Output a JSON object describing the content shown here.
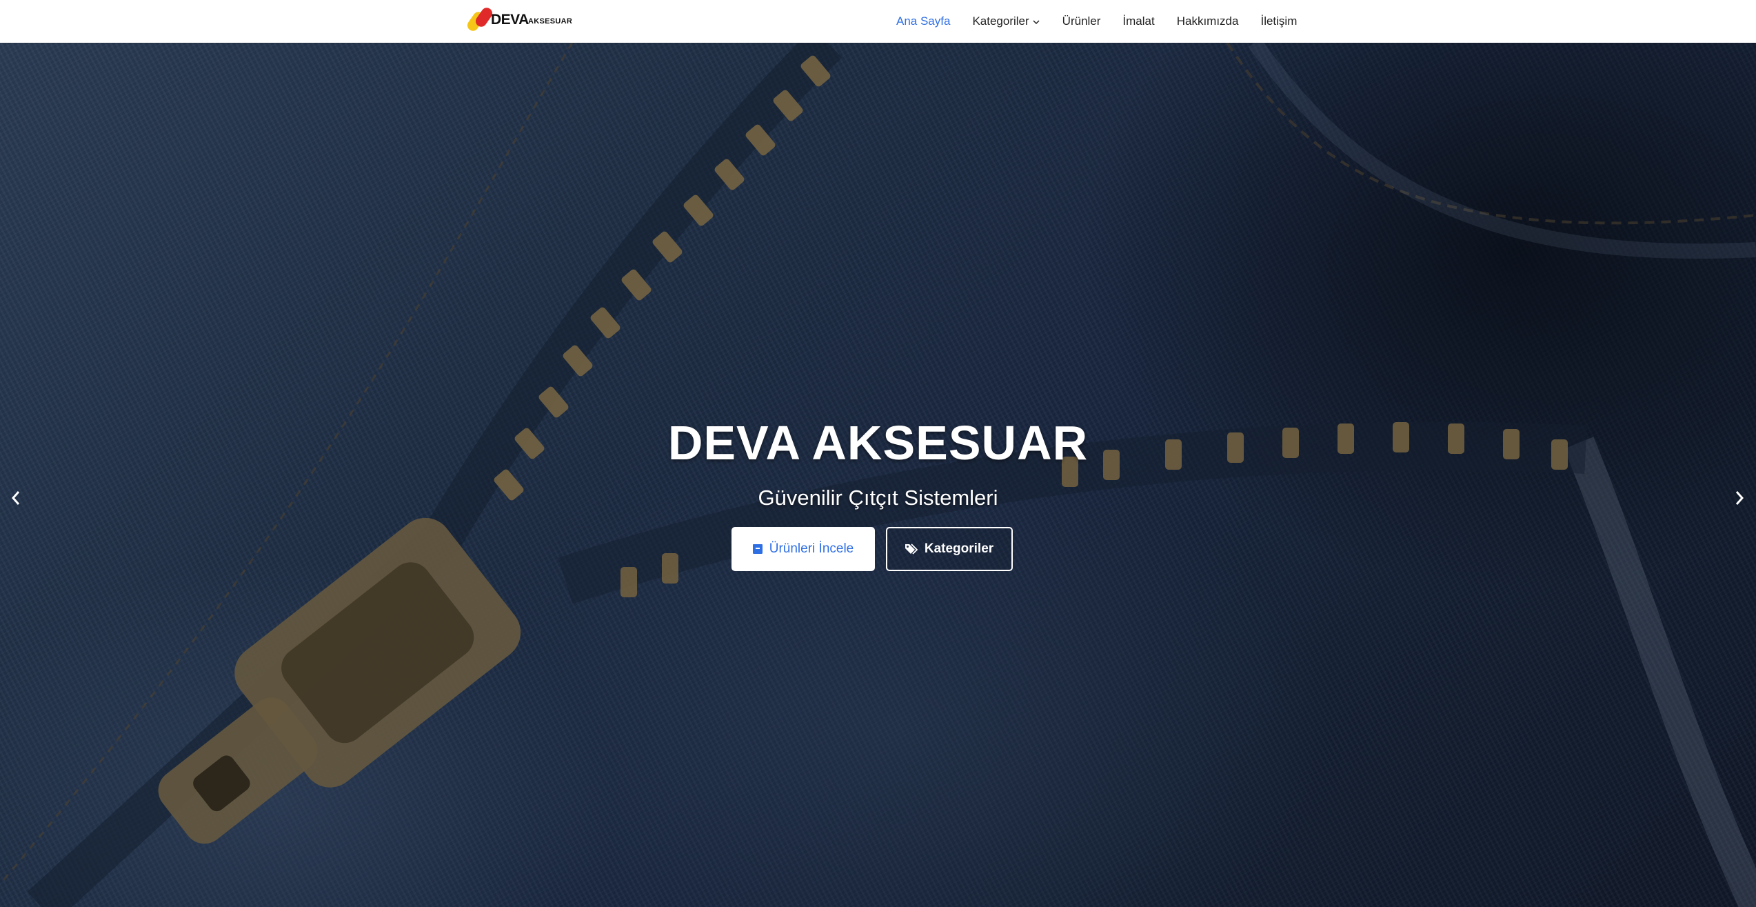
{
  "brand": {
    "name": "DEVA",
    "tagline": "AKSESUAR",
    "colors": {
      "red": "#e02a2a",
      "yellow": "#f5c518"
    }
  },
  "nav": {
    "active_color": "#2f6fe4",
    "items": [
      {
        "label": "Ana Sayfa",
        "active": true
      },
      {
        "label": "Kategoriler",
        "dropdown": true,
        "icon": "chevron-down-icon"
      },
      {
        "label": "Ürünler"
      },
      {
        "label": "İmalat"
      },
      {
        "label": "Hakkımızda"
      },
      {
        "label": "İletişim"
      }
    ]
  },
  "hero": {
    "title": "DEVA AKSESUAR",
    "subtitle": "Güvenilir Çıtçıt Sistemleri",
    "background": "denim-zipper-photo",
    "buttons": {
      "primary": {
        "label": "Ürünleri İncele",
        "icon": "box-icon"
      },
      "secondary": {
        "label": "Kategoriler",
        "icon": "tags-icon"
      }
    },
    "prev_icon": "chevron-left-icon",
    "next_icon": "chevron-right-icon"
  }
}
